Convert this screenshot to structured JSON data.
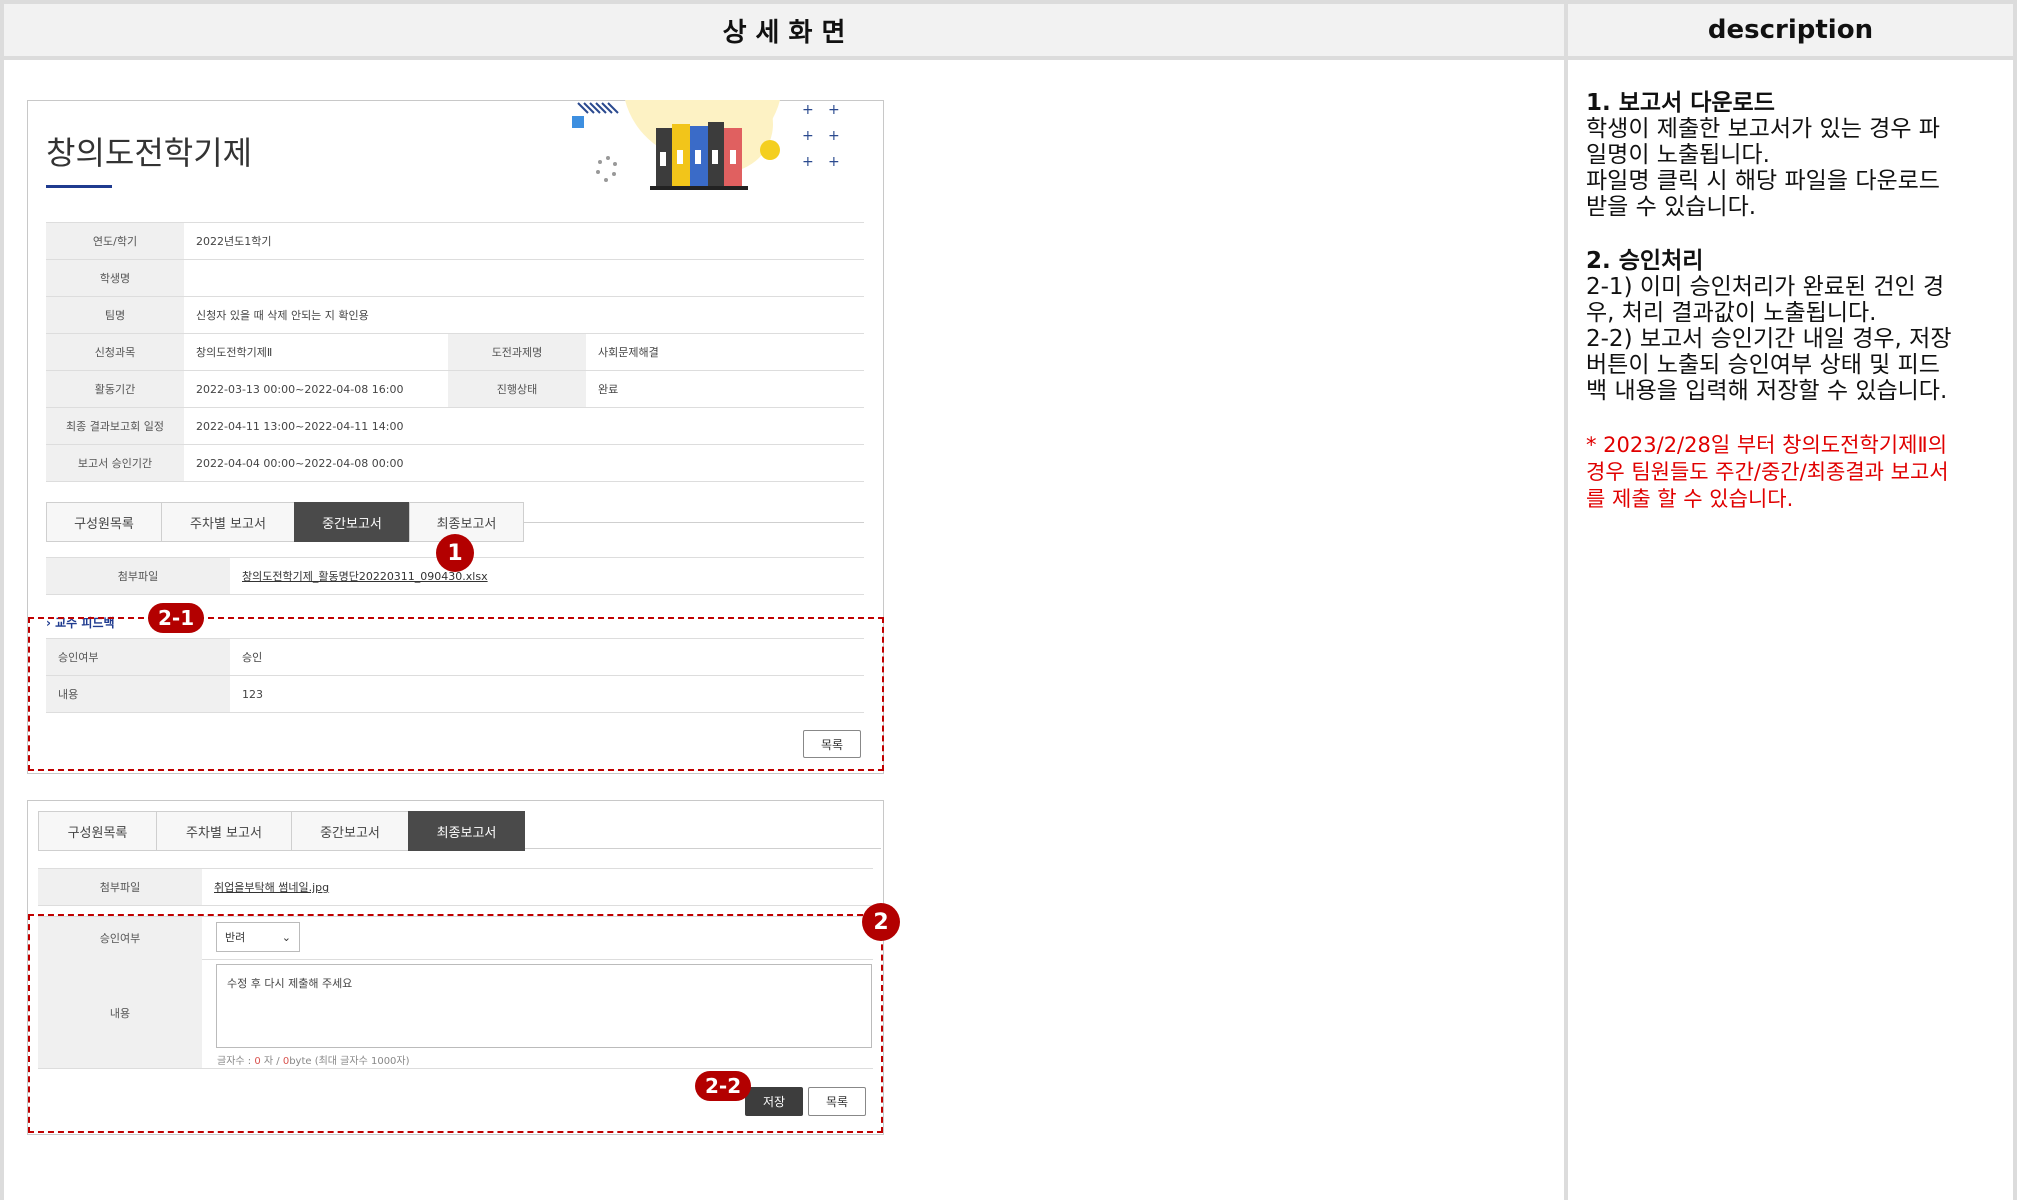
{
  "header": {
    "left_title": "상 세 화 면",
    "right_title": "description"
  },
  "panel1": {
    "title": "창의도전학기제",
    "info_rows": [
      {
        "label": "연도/학기",
        "value": "2022년도1학기"
      },
      {
        "label": "학생명",
        "value": ""
      },
      {
        "label": "팀명",
        "value": "신청자 있을 때 삭제 안되는 지 확인용"
      },
      {
        "label": "신청과목",
        "value": "창의도전학기제Ⅱ",
        "label2": "도전과제명",
        "value2": "사회문제해결"
      },
      {
        "label": "활동기간",
        "value": "2022-03-13 00:00~2022-04-08 16:00",
        "label2": "진행상태",
        "value2": "완료"
      },
      {
        "label": "최종 결과보고회 일정",
        "value": "2022-04-11 13:00~2022-04-11 14:00"
      },
      {
        "label": "보고서 승인기간",
        "value": "2022-04-04 00:00~2022-04-08 00:00"
      }
    ],
    "tabs": [
      "구성원목록",
      "주차별 보고서",
      "중간보고서",
      "최종보고서"
    ],
    "active_tab": "중간보고서",
    "attach_label": "첨부파일",
    "attach_file": "창의도전학기제_활동명단20220311_090430.xlsx",
    "feedback_section": "교수 피드백",
    "approval_label": "승인여부",
    "approval_value": "승인",
    "content_label": "내용",
    "content_value": "123",
    "list_button": "목록"
  },
  "panel2": {
    "tabs": [
      "구성원목록",
      "주차별 보고서",
      "중간보고서",
      "최종보고서"
    ],
    "active_tab": "최종보고서",
    "attach_label": "첨부파일",
    "attach_file": "취업을부탁해 썸네일.jpg",
    "approval_label": "승인여부",
    "approval_select": "반려",
    "content_label": "내용",
    "content_text": "수정 후 다시 제출해 주세요",
    "counter_prefix": "글자수 : ",
    "counter_chars": "0",
    "counter_mid": " 자 / ",
    "counter_bytes": "0",
    "counter_suffix": "byte (최대 글자수 1000자)",
    "save_button": "저장",
    "list_button": "목록"
  },
  "markers": {
    "m1": "1",
    "m2": "2",
    "m21": "2-1",
    "m22": "2-2"
  },
  "description": {
    "s1_title": "1. 보고서 다운로드",
    "s1_line1": "학생이 제출한 보고서가 있는 경우 파",
    "s1_line2": "일명이 노출됩니다.",
    "s1_line3": "파일명 클릭 시 해당 파일을 다운로드",
    "s1_line4": "받을 수 있습니다.",
    "s2_title": "2. 승인처리",
    "s2_line1": "2-1) 이미 승인처리가 완료된 건인 경",
    "s2_line2": "우, 처리 결과값이 노출됩니다.",
    "s2_line3": "2-2) 보고서 승인기간 내일 경우, 저장",
    "s2_line4": "버튼이 노출되 승인여부 상태 및 피드",
    "s2_line5": "백 내용을 입력해 저장할 수 있습니다.",
    "note_line1": " * 2023/2/28일 부터 창의도전학기제Ⅱ의",
    "note_line2": "경우 팀원들도 주간/중간/최종결과 보고서",
    "note_line3": "를 제출 할 수 있습니다."
  },
  "colors": {
    "accent_blue": "#1f3b8f",
    "marker_red": "#b30000",
    "note_red": "#e00000",
    "active_tab": "#4a4a4a"
  }
}
